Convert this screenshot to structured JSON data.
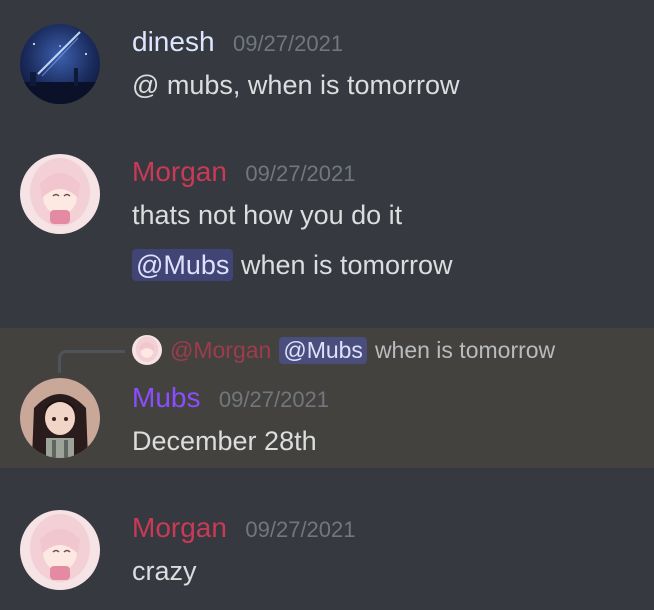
{
  "messages": [
    {
      "username": "dinesh",
      "username_color": "#dde6ff",
      "timestamp": "09/27/2021",
      "lines": [
        "@ mubs, when is tomorrow"
      ]
    },
    {
      "username": "Morgan",
      "username_color": "#c93a56",
      "timestamp": "09/27/2021",
      "line1": "thats not how you do it",
      "line2_mention": "@Mubs",
      "line2_text": " when is tomorrow"
    },
    {
      "reply": {
        "user": "@Morgan",
        "mention": "@Mubs",
        "text": "when is tomorrow"
      },
      "username": "Mubs",
      "username_color": "#8a4dff",
      "timestamp": "09/27/2021",
      "lines": [
        "December 28th"
      ]
    },
    {
      "username": "Morgan",
      "username_color": "#c93a56",
      "timestamp": "09/27/2021",
      "lines": [
        "crazy"
      ]
    }
  ],
  "colors": {
    "background": "#36393f",
    "highlight": "#43423e",
    "mention_bg": "#4a4f87",
    "timestamp": "#72767d",
    "text": "#dcddde"
  }
}
